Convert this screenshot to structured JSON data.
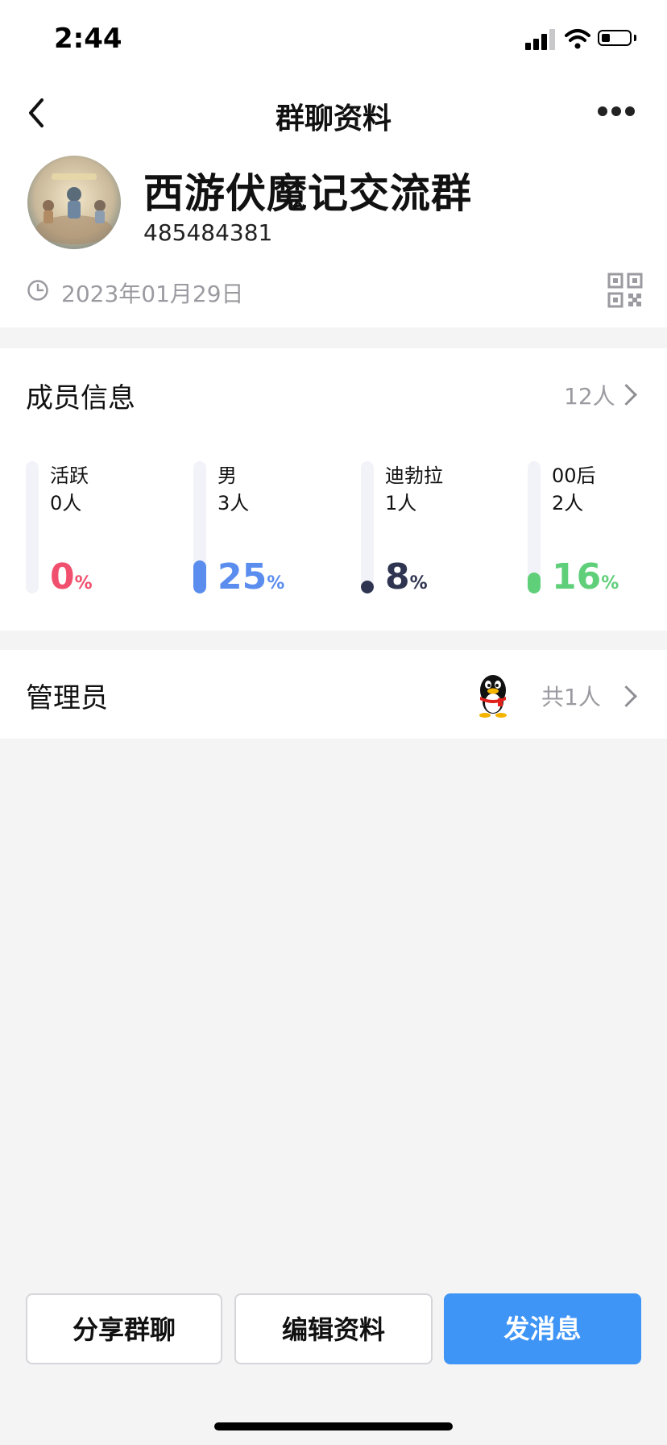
{
  "status_bar": {
    "time": "2:44"
  },
  "header": {
    "title": "群聊资料"
  },
  "group": {
    "name": "西游伏魔记交流群",
    "id": "485484381",
    "created": "2023年01月29日"
  },
  "members": {
    "title": "成员信息",
    "count": "12人",
    "stats": [
      {
        "label": "活跃",
        "count": "0人",
        "percent": "0",
        "fraction": 0.0,
        "color": "#f0506e"
      },
      {
        "label": "男",
        "count": "3人",
        "percent": "25",
        "fraction": 0.25,
        "color": "#5b8def"
      },
      {
        "label": "迪勃拉",
        "count": "1人",
        "percent": "8",
        "fraction": 0.08,
        "color": "#2f3550"
      },
      {
        "label": "00后",
        "count": "2人",
        "percent": "16",
        "fraction": 0.16,
        "color": "#5fcf7a"
      }
    ]
  },
  "admins": {
    "title": "管理员",
    "count": "共1人"
  },
  "actions": {
    "share": "分享群聊",
    "edit": "编辑资料",
    "message": "发消息"
  },
  "colors": {
    "accent": "#3f95f5",
    "background": "#f4f4f5"
  }
}
